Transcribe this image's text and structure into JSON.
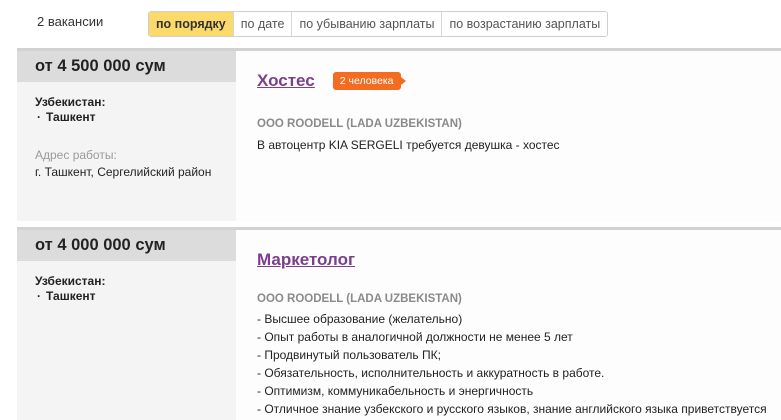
{
  "header": {
    "count": "2 вакансии",
    "sort_options": [
      {
        "label": "по порядку",
        "active": true
      },
      {
        "label": "по дате",
        "active": false
      },
      {
        "label": "по убыванию зарплаты",
        "active": false
      },
      {
        "label": "по возрастанию зарплаты",
        "active": false
      }
    ]
  },
  "vacancies": [
    {
      "salary": "от 4 500 000 сум",
      "region": "Узбекистан:",
      "city": "Ташкент",
      "address_label": "Адрес работы:",
      "address": "г. Ташкент, Сергелийский район",
      "title": "Хостес",
      "badge": "2 человека",
      "company": "ООО ROODELL (LADA UZBEKISTAN)",
      "description": [
        "В автоцентр KIA SERGELI требуется девушка - хостес"
      ]
    },
    {
      "salary": "от 4 000 000 сум",
      "region": "Узбекистан:",
      "city": "Ташкент",
      "title": "Маркетолог",
      "company": "ООО ROODELL (LADA UZBEKISTAN)",
      "description": [
        "- Высшее образование (желательно)",
        "- Опыт работы в аналогичной должности не менее 5 лет",
        "- Продвинутый пользователь ПК;",
        "- Обязательность, исполнительность и аккуратность в работе.",
        "- Оптимизм, коммуникабельность и энергичность",
        "- Отличное знание узбекского и русского языков, знание английского языка приветствуется"
      ]
    }
  ],
  "colors": {
    "active_sort": "#fcd96b",
    "title_link": "#7b3f8c",
    "badge": "#f26d21",
    "salary_bg": "#dcdcdc",
    "card_bg": "#f4f4f4"
  }
}
